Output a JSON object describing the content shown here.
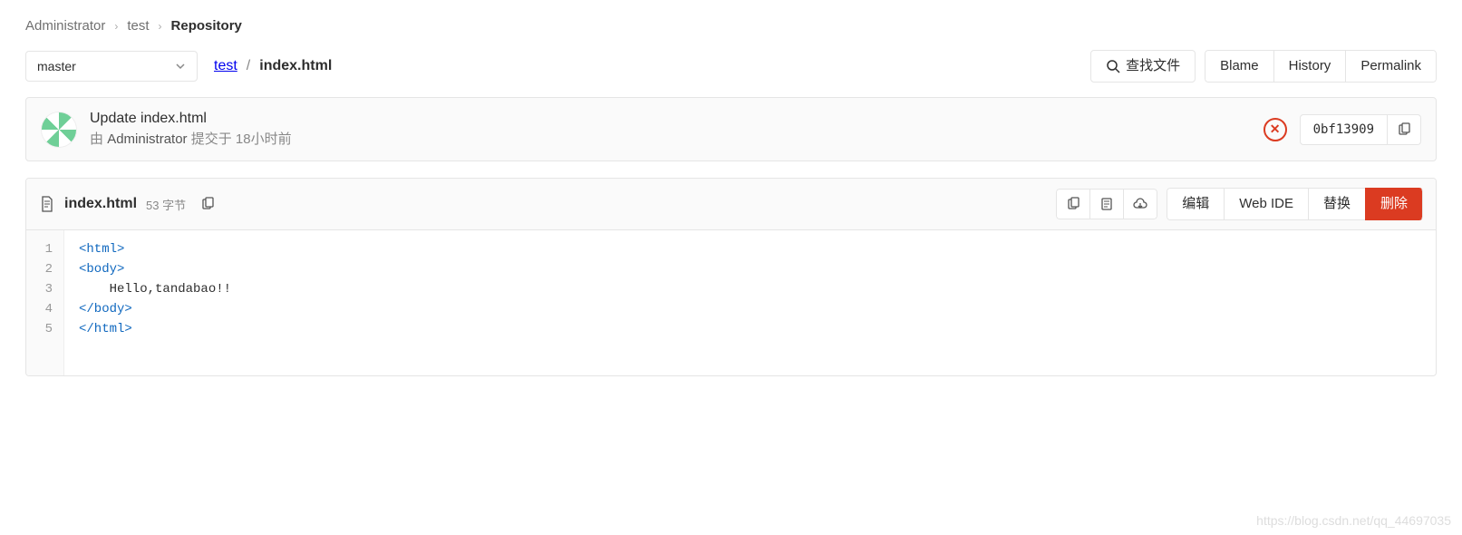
{
  "breadcrumb": {
    "items": [
      "Administrator",
      "test",
      "Repository"
    ]
  },
  "branch": "master",
  "path": {
    "root": "test",
    "file": "index.html"
  },
  "buttons": {
    "find": "查找文件",
    "blame": "Blame",
    "history": "History",
    "permalink": "Permalink",
    "edit": "编辑",
    "webide": "Web IDE",
    "replace": "替换",
    "delete": "删除"
  },
  "commit": {
    "title": "Update index.html",
    "by_prefix": "由",
    "author": "Administrator",
    "submitted": "提交于",
    "time": "18小时前",
    "sha": "0bf13909"
  },
  "file": {
    "name": "index.html",
    "size": "53 字节"
  },
  "code": {
    "lines": [
      "<html>",
      "<body>",
      "    Hello,tandabao!!",
      "</body>",
      "</html>"
    ]
  },
  "watermark": "https://blog.csdn.net/qq_44697035"
}
